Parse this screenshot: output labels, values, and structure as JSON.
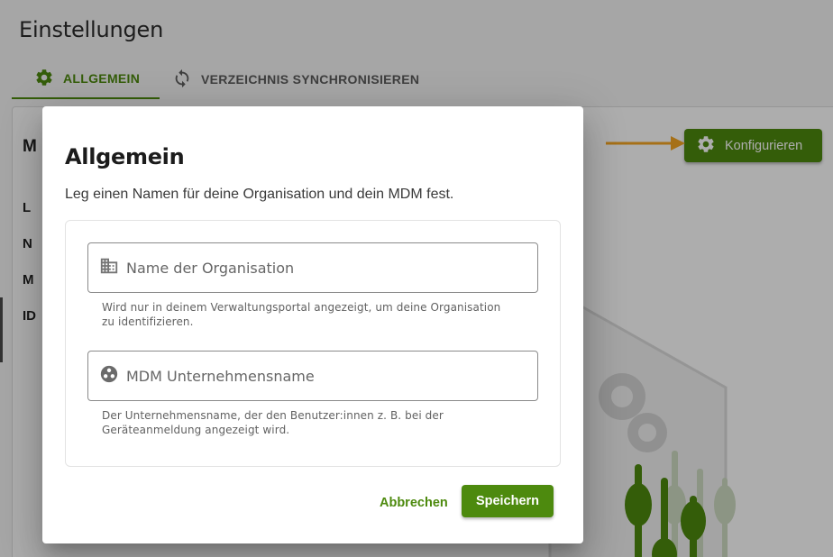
{
  "page": {
    "title": "Einstellungen"
  },
  "tabs": [
    {
      "label": "ALLGEMEIN",
      "icon": "gear-icon",
      "active": true
    },
    {
      "label": "VERZEICHNIS SYNCHRONISIEREN",
      "icon": "sync-icon",
      "active": false
    }
  ],
  "background": {
    "configure_button": "Konfigurieren",
    "partial_labels": [
      "M",
      "L",
      "N",
      "M",
      "ID"
    ]
  },
  "dialog": {
    "title": "Allgemein",
    "description": "Leg einen Namen für deine Organisation und dein MDM fest.",
    "fields": [
      {
        "icon": "building-icon",
        "placeholder": "Name der Organisation",
        "value": "",
        "hint": "Wird nur in deinem Verwaltungsportal angezeigt, um deine Organisation zu identifizieren."
      },
      {
        "icon": "community-icon",
        "placeholder": "MDM Unternehmensname",
        "value": "",
        "hint": "Der Unternehmensname, der den Benutzer:innen z. B. bei der Geräteanmeldung angezeigt wird."
      }
    ],
    "cancel_label": "Abbrechen",
    "save_label": "Speichern"
  },
  "colors": {
    "accent": "#4d8a0e",
    "annotation_arrow": "#f5a623",
    "overlay": "rgba(0,0,0,0.32)"
  }
}
